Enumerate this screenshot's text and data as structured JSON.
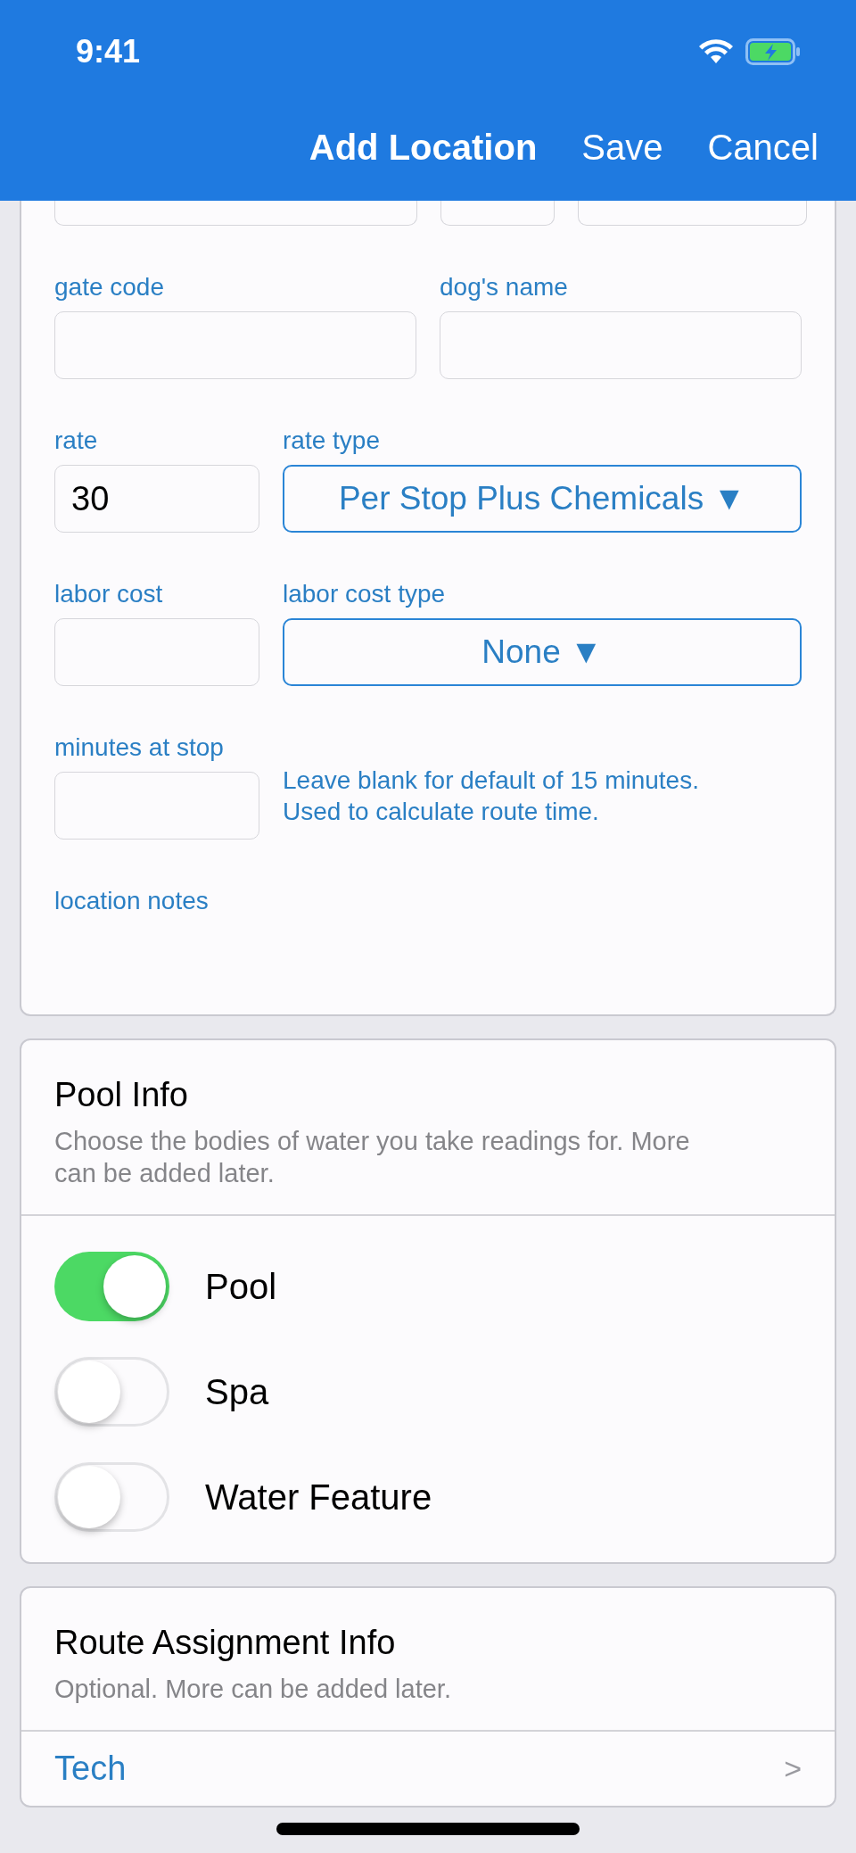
{
  "status_bar": {
    "time": "9:41"
  },
  "nav": {
    "title": "Add Location",
    "actions": [
      "Save",
      "Cancel"
    ]
  },
  "location_form": {
    "rows": [
      {
        "kind": "even",
        "fields": [
          {
            "kind": "input",
            "label": "gate code"
          },
          {
            "kind": "input",
            "label": "dog's name"
          }
        ]
      },
      {
        "kind": "split",
        "fields": [
          {
            "kind": "input",
            "label": "rate",
            "value": "30"
          },
          {
            "kind": "select",
            "label": "rate type",
            "value": "Per Stop Plus Chemicals ▼"
          }
        ]
      },
      {
        "kind": "split",
        "fields": [
          {
            "kind": "input",
            "label": "labor cost"
          },
          {
            "kind": "select",
            "label": "labor cost type",
            "value": "None ▼"
          }
        ]
      },
      {
        "kind": "split",
        "fields": [
          {
            "kind": "input",
            "label": "minutes at stop"
          },
          {
            "kind": "hint",
            "value": "Leave blank for default of 15 minutes. Used to calculate route time."
          }
        ]
      },
      {
        "kind": "full",
        "fields": [
          {
            "kind": "notes",
            "label": "location notes"
          }
        ]
      }
    ]
  },
  "pool_info": {
    "title": "Pool Info",
    "subtitle": "Choose the bodies of water you take readings for. More can be added later.",
    "toggles": [
      {
        "label": "Pool",
        "on": true
      },
      {
        "label": "Spa",
        "on": false
      },
      {
        "label": "Water Feature",
        "on": false
      }
    ]
  },
  "route_info": {
    "title": "Route Assignment Info",
    "subtitle": "Optional. More can be added later.",
    "rows": [
      {
        "label": "Tech",
        "chevron": ">"
      }
    ]
  }
}
